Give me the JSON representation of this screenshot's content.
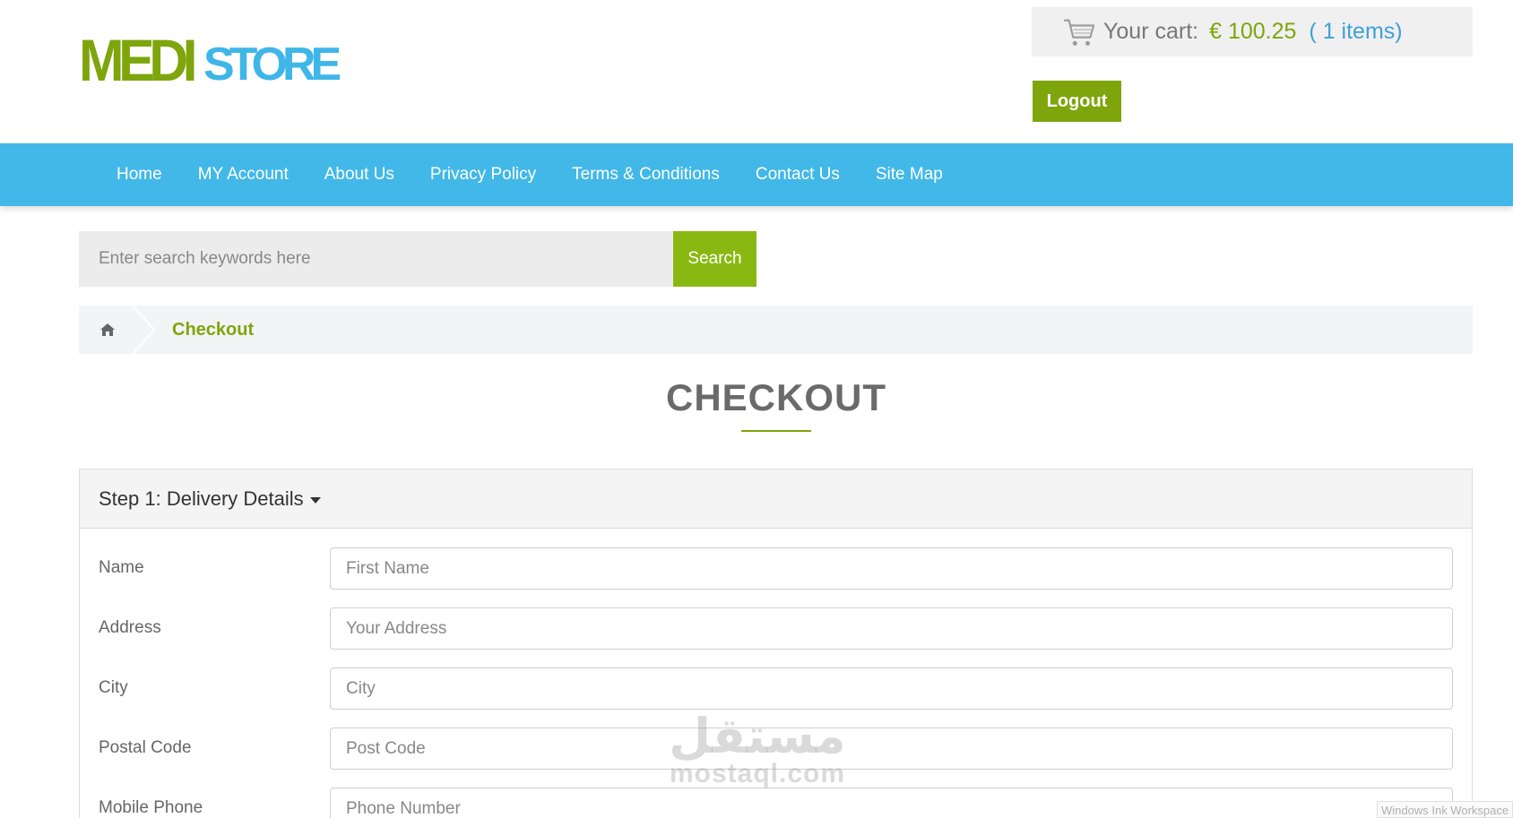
{
  "brand": {
    "logo_part1": "MEDI",
    "logo_part2": "STORE",
    "color_primary": "#7ea50c",
    "color_secondary": "#3fb6e8"
  },
  "cart": {
    "icon": "shopping-cart-icon",
    "label": "Your cart:",
    "total": "€ 100.25",
    "items": "( 1 items)"
  },
  "account": {
    "logout_label": "Logout"
  },
  "nav": {
    "items": [
      {
        "label": "Home"
      },
      {
        "label": "MY Account"
      },
      {
        "label": "About Us"
      },
      {
        "label": "Privacy Policy"
      },
      {
        "label": "Terms & Conditions"
      },
      {
        "label": "Contact Us"
      },
      {
        "label": "Site Map"
      }
    ]
  },
  "search": {
    "placeholder": "Enter search keywords here",
    "value": "",
    "button_label": "Search"
  },
  "breadcrumb": {
    "home_icon": "home-icon",
    "current": "Checkout"
  },
  "page": {
    "title": "CHECKOUT"
  },
  "step1": {
    "title": "Step 1: Delivery Details",
    "fields": [
      {
        "label": "Name",
        "placeholder": "First Name",
        "value": ""
      },
      {
        "label": "Address",
        "placeholder": "Your Address",
        "value": ""
      },
      {
        "label": "City",
        "placeholder": "City",
        "value": ""
      },
      {
        "label": "Postal Code",
        "placeholder": "Post Code",
        "value": ""
      },
      {
        "label": "Mobile Phone",
        "placeholder": "Phone Number",
        "value": ""
      }
    ]
  },
  "watermark": {
    "arabic": "مستقل",
    "latin": "mostaql.com"
  },
  "overlay": {
    "ink_workspace": "Windows Ink Workspace"
  }
}
